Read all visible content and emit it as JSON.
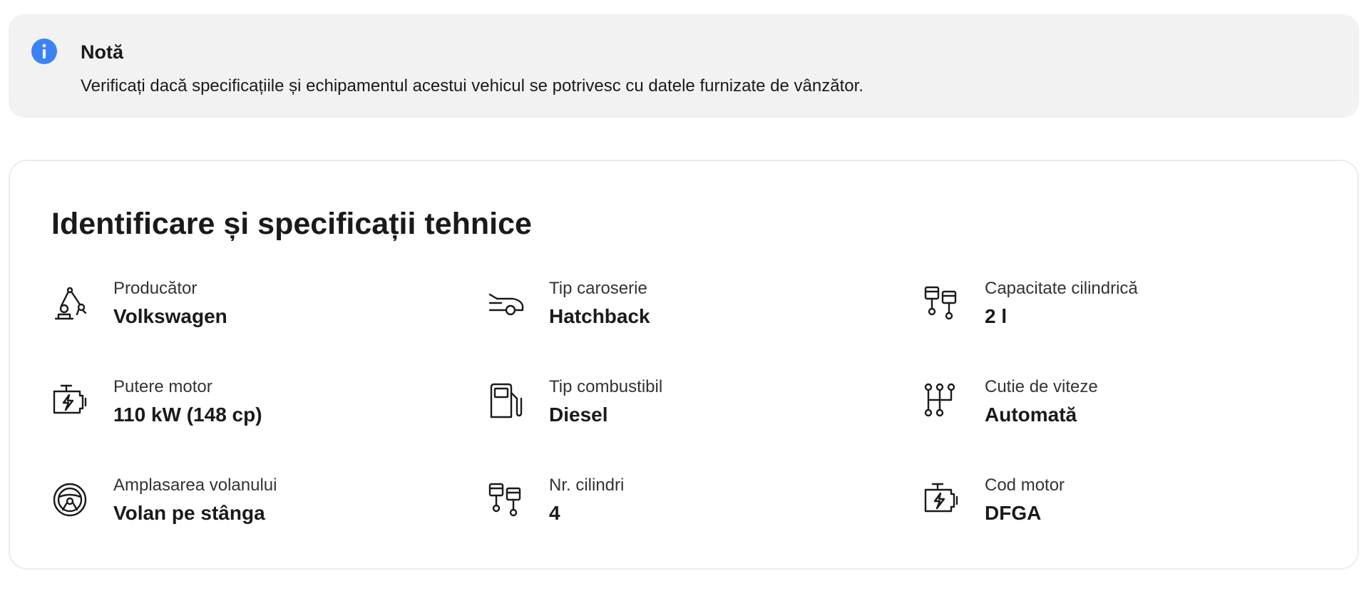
{
  "note": {
    "icon": "info-icon",
    "icon_color": "#3b82f6",
    "title": "Notă",
    "text": "Verificați dacă specificațiile și echipamentul acestui vehicul se potrivesc cu datele furnizate de vânzător."
  },
  "specs": {
    "title": "Identificare și specificații tehnice",
    "items": [
      {
        "icon": "manufacturer-robot-arm-icon",
        "label": "Producător",
        "value": "Volkswagen"
      },
      {
        "icon": "car-body-icon",
        "label": "Tip caroserie",
        "value": "Hatchback"
      },
      {
        "icon": "pistons-icon",
        "label": "Capacitate cilindrică",
        "value": "2 l"
      },
      {
        "icon": "engine-icon",
        "label": "Putere motor",
        "value": "110 kW (148 cp)"
      },
      {
        "icon": "fuel-pump-icon",
        "label": "Tip combustibil",
        "value": "Diesel"
      },
      {
        "icon": "gearbox-icon",
        "label": "Cutie de viteze",
        "value": "Automată"
      },
      {
        "icon": "steering-wheel-icon",
        "label": "Amplasarea volanului",
        "value": "Volan pe stânga"
      },
      {
        "icon": "pistons-icon",
        "label": "Nr. cilindri",
        "value": "4"
      },
      {
        "icon": "engine-icon",
        "label": "Cod motor",
        "value": "DFGA"
      }
    ]
  }
}
